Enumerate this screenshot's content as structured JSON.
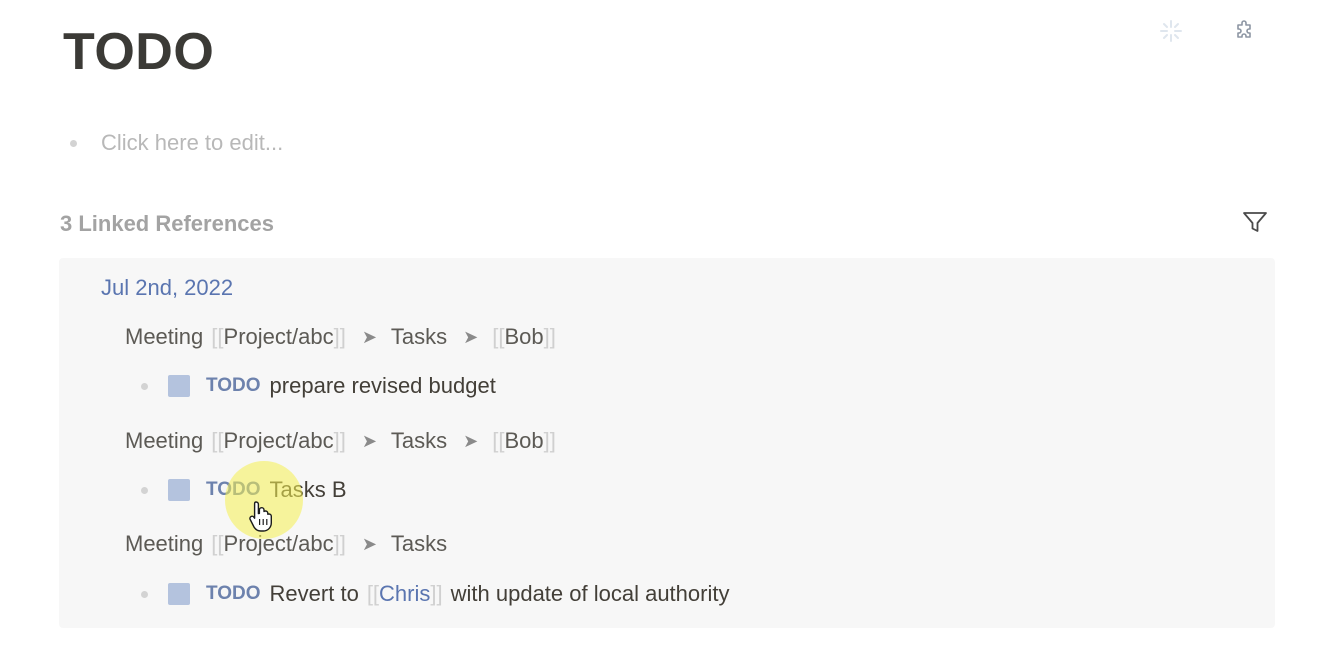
{
  "page": {
    "title": "TODO",
    "edit_placeholder": "Click here to edit..."
  },
  "toolbar": {
    "icons": [
      "sparkle-icon",
      "puzzle-icon"
    ]
  },
  "linked_refs": {
    "header": "3 Linked References",
    "filter_icon": "filter-icon",
    "groups": [
      {
        "date": "Jul 2nd, 2022",
        "blocks": [
          {
            "breadcrumb": {
              "prefix": "Meeting",
              "project": "Project/abc",
              "tasks": "Tasks",
              "person": "Bob"
            },
            "task": {
              "marker": "TODO",
              "text": "prepare revised budget"
            }
          },
          {
            "breadcrumb": {
              "prefix": "Meeting",
              "project": "Project/abc",
              "tasks": "Tasks",
              "person": "Bob"
            },
            "task": {
              "marker": "TODO",
              "text": "Tasks B"
            }
          },
          {
            "breadcrumb": {
              "prefix": "Meeting",
              "project": "Project/abc",
              "tasks": "Tasks"
            },
            "task": {
              "marker": "TODO",
              "text_before": "Revert to",
              "ref": "Chris",
              "text_after": "with update of local authority"
            }
          }
        ]
      }
    ]
  },
  "brackets": {
    "open": "[[",
    "close": "]]"
  },
  "separator": "➤",
  "colors": {
    "accent_link": "#5a75b0",
    "todo_marker": "#6d82ad",
    "checkbox": "#b4c3de",
    "panel_bg": "#f7f7f7",
    "cursor_highlight": "#f5f050"
  }
}
